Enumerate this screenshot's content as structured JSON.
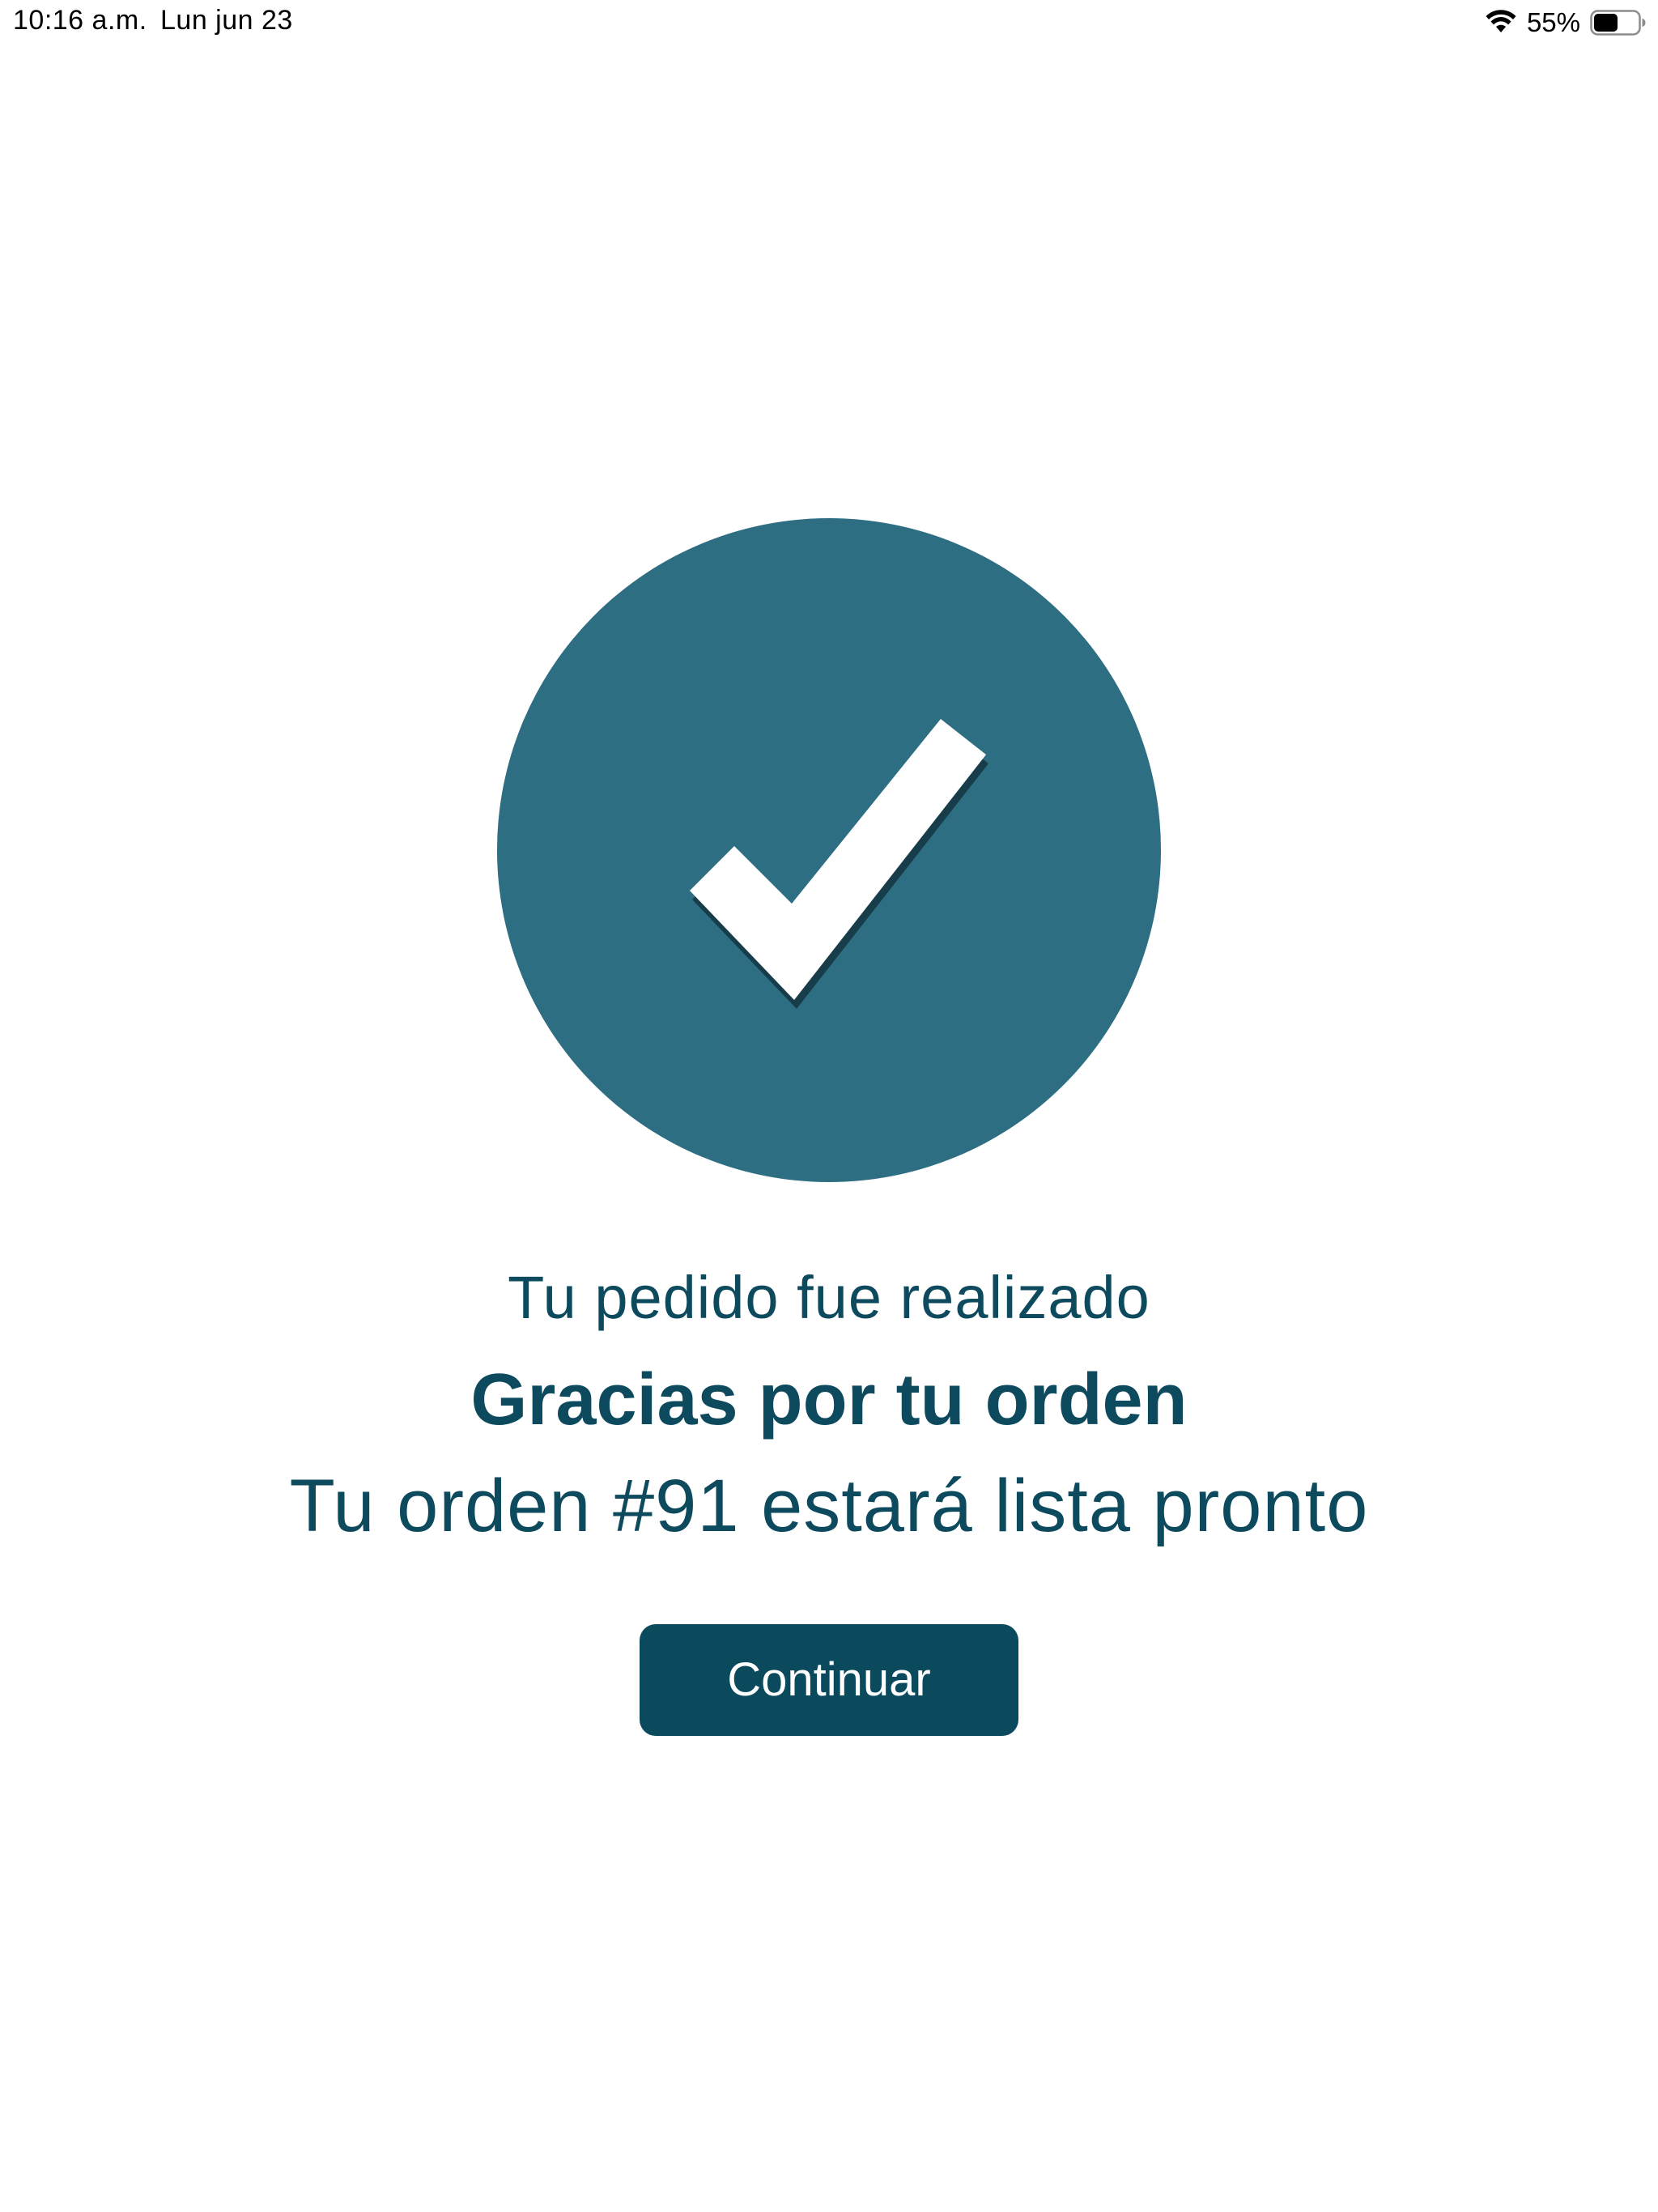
{
  "status_bar": {
    "time": "10:16 a.m.",
    "date": "Lun jun 23",
    "battery_percent": "55%",
    "battery_level": 0.55,
    "icons": [
      "wifi-icon",
      "battery-icon"
    ]
  },
  "confirmation": {
    "icon": "checkmark-icon",
    "circle_color": "#2e6e82",
    "headline": "Tu pedido fue realizado",
    "title": "Gracias por tu orden",
    "message": "Tu orden #91 estará lista pronto"
  },
  "actions": {
    "continue_label": "Continuar",
    "button_color": "#0b495d"
  }
}
